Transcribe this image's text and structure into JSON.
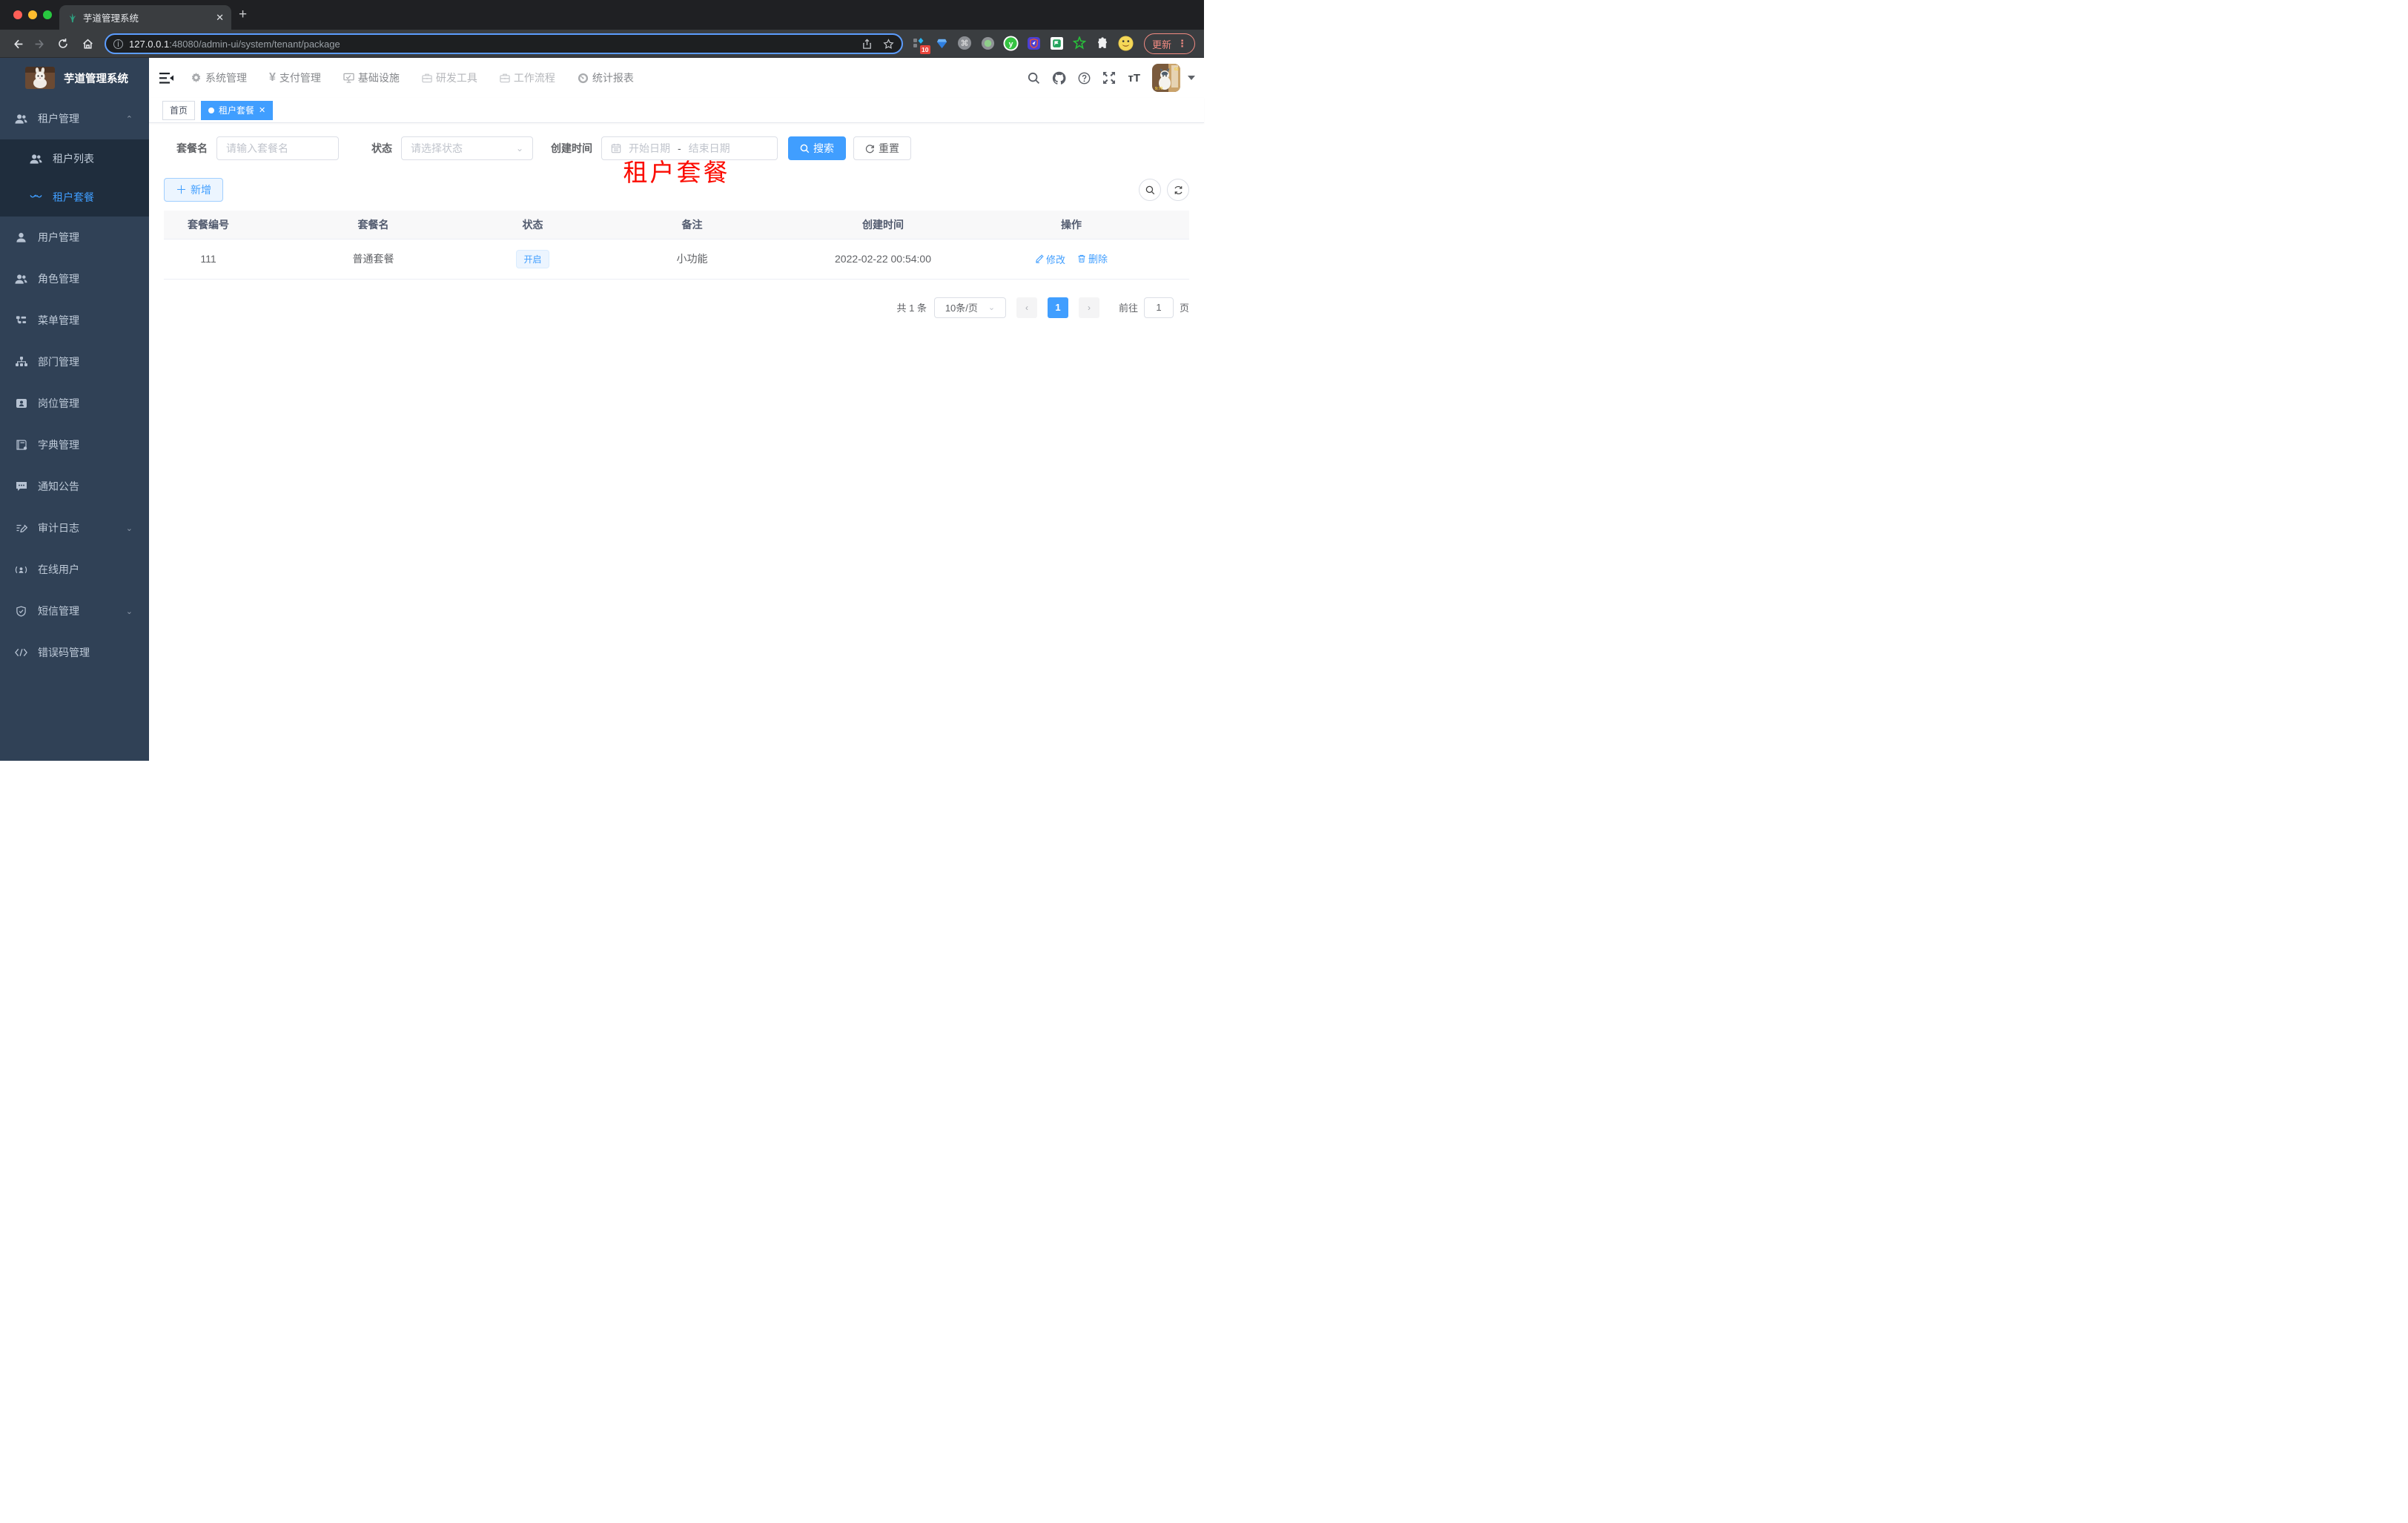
{
  "browser": {
    "tab_title": "芋道管理系统",
    "new_tab": "+",
    "close_tab": "✕",
    "url_host": "127.0.0.1",
    "url_rest": ":48080/admin-ui/system/tenant/package",
    "extension_badge": "10",
    "update_label": "更新"
  },
  "app": {
    "logo_title": "芋道管理系统",
    "top_nav": [
      {
        "label": "系统管理"
      },
      {
        "label": "支付管理"
      },
      {
        "label": "基础设施"
      },
      {
        "label": "研发工具"
      },
      {
        "label": "工作流程"
      },
      {
        "label": "统计报表"
      }
    ],
    "sidebar": {
      "items": [
        {
          "label": "租户管理"
        },
        {
          "label": "租户列表"
        },
        {
          "label": "租户套餐"
        },
        {
          "label": "用户管理"
        },
        {
          "label": "角色管理"
        },
        {
          "label": "菜单管理"
        },
        {
          "label": "部门管理"
        },
        {
          "label": "岗位管理"
        },
        {
          "label": "字典管理"
        },
        {
          "label": "通知公告"
        },
        {
          "label": "审计日志"
        },
        {
          "label": "在线用户"
        },
        {
          "label": "短信管理"
        },
        {
          "label": "错误码管理"
        }
      ]
    },
    "tags": {
      "home": "首页",
      "active": "租户套餐"
    },
    "overlay_title": "租户套餐",
    "filters": {
      "name_label": "套餐名",
      "name_placeholder": "请输入套餐名",
      "status_label": "状态",
      "status_placeholder": "请选择状态",
      "date_label": "创建时间",
      "date_start_placeholder": "开始日期",
      "date_separator": "-",
      "date_end_placeholder": "结束日期",
      "search_label": "搜索",
      "reset_label": "重置"
    },
    "toolbar": {
      "add_label": "新增"
    },
    "table": {
      "headers": [
        "套餐编号",
        "套餐名",
        "状态",
        "备注",
        "创建时间",
        "操作"
      ],
      "row": {
        "id": "111",
        "name": "普通套餐",
        "status": "开启",
        "remark": "小功能",
        "created": "2022-02-22 00:54:00",
        "edit_label": "修改",
        "delete_label": "删除"
      }
    },
    "pagination": {
      "total": "共 1 条",
      "page_size": "10条/页",
      "prev": "‹",
      "page": "1",
      "next": "›",
      "goto_label": "前往",
      "goto_value": "1",
      "page_suffix": "页"
    },
    "accent_color": "#409eff"
  }
}
